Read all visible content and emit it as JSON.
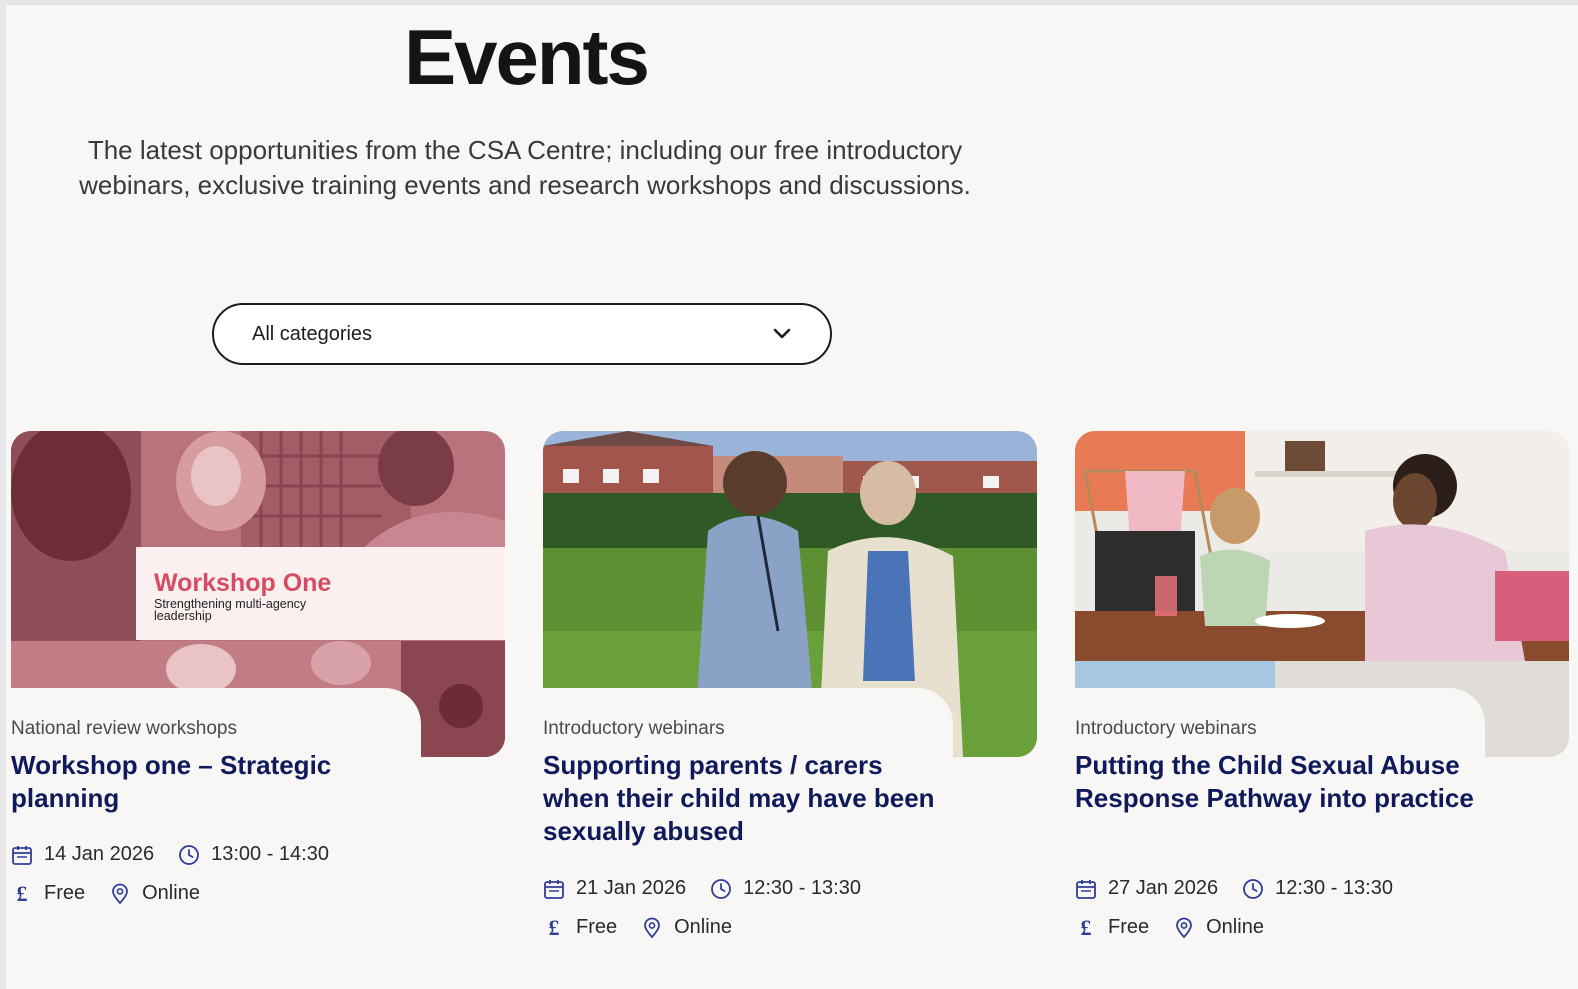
{
  "page": {
    "title": "Events",
    "intro": "The latest opportunities from the CSA Centre; including our free introductory webinars, exclusive training events and research workshops and discussions."
  },
  "filter": {
    "selected": "All categories"
  },
  "colors": {
    "title_blue": "#0f1a5b",
    "icon_blue": "#2f3d99",
    "overlay_pink": "#d64c60"
  },
  "icons": {
    "date": "calendar-icon",
    "time": "clock-icon",
    "price": "pound-icon",
    "location": "location-pin-icon",
    "dropdown": "chevron-down-icon"
  },
  "events": [
    {
      "category": "National review workshops",
      "title": "Workshop one – Strategic planning",
      "date": "14 Jan 2026",
      "time": "13:00 - 14:30",
      "price": "Free",
      "price_symbol": "£",
      "location": "Online",
      "image_overlay_title": "Workshop One",
      "image_overlay_subtitle": "Strengthening multi-agency leadership"
    },
    {
      "category": "Introductory webinars",
      "title": "Supporting parents / carers when their child may have been sexually abused",
      "date": "21 Jan 2026",
      "time": "12:30 - 13:30",
      "price": "Free",
      "price_symbol": "£",
      "location": "Online"
    },
    {
      "category": "Introductory webinars",
      "title": "Putting the Child Sexual Abuse Response Pathway into practice",
      "date": "27 Jan 2026",
      "time": "12:30 - 13:30",
      "price": "Free",
      "price_symbol": "£",
      "location": "Online"
    }
  ]
}
